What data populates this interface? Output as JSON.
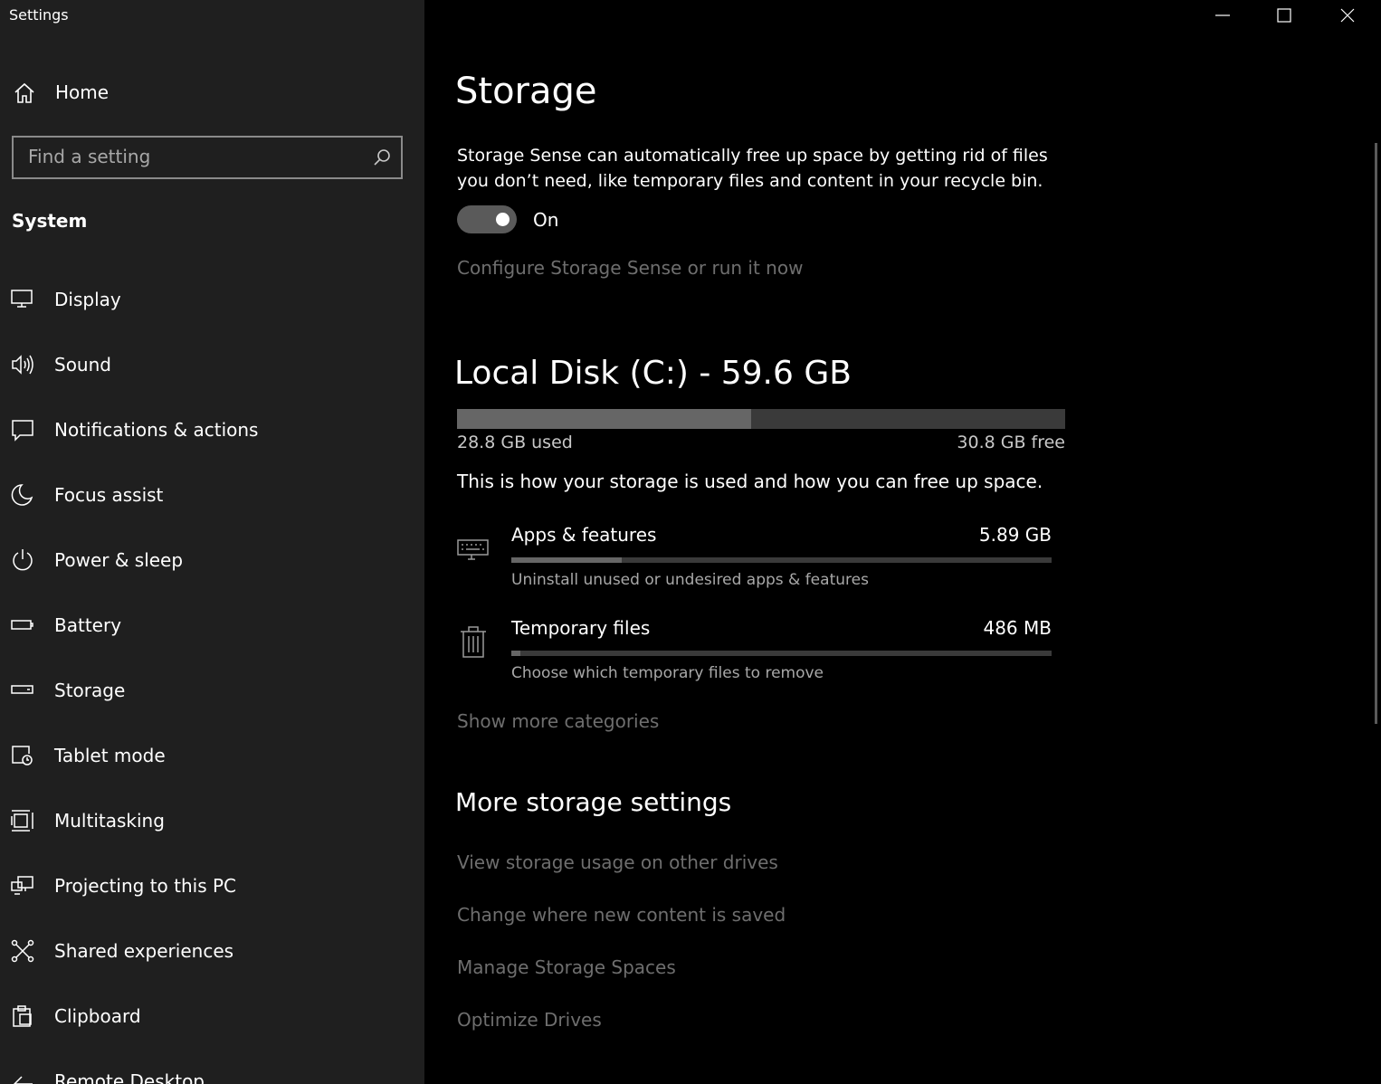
{
  "window": {
    "title": "Settings"
  },
  "sidebar": {
    "home_label": "Home",
    "search_placeholder": "Find a setting",
    "section_title": "System",
    "items": [
      {
        "label": "Display",
        "icon": "monitor-icon"
      },
      {
        "label": "Sound",
        "icon": "speaker-icon"
      },
      {
        "label": "Notifications & actions",
        "icon": "notification-icon"
      },
      {
        "label": "Focus assist",
        "icon": "moon-icon"
      },
      {
        "label": "Power & sleep",
        "icon": "power-icon"
      },
      {
        "label": "Battery",
        "icon": "battery-icon"
      },
      {
        "label": "Storage",
        "icon": "storage-icon"
      },
      {
        "label": "Tablet mode",
        "icon": "tablet-icon"
      },
      {
        "label": "Multitasking",
        "icon": "multitasking-icon"
      },
      {
        "label": "Projecting to this PC",
        "icon": "projecting-icon"
      },
      {
        "label": "Shared experiences",
        "icon": "shared-icon"
      },
      {
        "label": "Clipboard",
        "icon": "clipboard-icon"
      },
      {
        "label": "Remote Desktop",
        "icon": "remote-desktop-icon"
      }
    ]
  },
  "main": {
    "title": "Storage",
    "storage_sense_desc": "Storage Sense can automatically free up space by getting rid of files you don’t need, like temporary files and content in your recycle bin.",
    "toggle_state": "On",
    "toggle_on": true,
    "configure_link": "Configure Storage Sense or run it now",
    "disk": {
      "title": "Local Disk (C:) - 59.6 GB",
      "used_label": "28.8 GB used",
      "free_label": "30.8 GB free",
      "used_fraction": 0.483
    },
    "usage_desc": "This is how your storage is used and how you can free up space.",
    "categories": [
      {
        "name": "Apps & features",
        "size": "5.89 GB",
        "sub": "Uninstall unused or undesired apps & features",
        "fraction": 0.205
      },
      {
        "name": "Temporary files",
        "size": "486 MB",
        "sub": "Choose which temporary files to remove",
        "fraction": 0.017
      }
    ],
    "show_more_link": "Show more categories",
    "more_title": "More storage settings",
    "more_links": [
      "View storage usage on other drives",
      "Change where new content is saved",
      "Manage Storage Spaces",
      "Optimize Drives"
    ]
  },
  "colors": {
    "sidebar_bg": "#1f1f1f",
    "content_bg": "#000000",
    "link_color": "#6e6e6e",
    "bar_fill": "#666666",
    "bar_track": "#3a3a3a"
  }
}
